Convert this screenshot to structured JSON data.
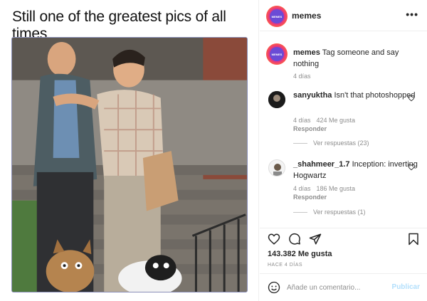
{
  "meme": {
    "caption": "Still one of the greatest pics of all times"
  },
  "post": {
    "username": "memes",
    "avatar_label": "MEMES",
    "caption": "Tag someone and say nothing",
    "caption_time": "4 días"
  },
  "comments": [
    {
      "username": "sanyuktha",
      "text": "Isn't that photoshopped",
      "time": "4 días",
      "likes": "424 Me gusta",
      "reply_label": "Responder",
      "view_replies": "Ver respuestas (23)"
    },
    {
      "username": "_shahmeer_1.7",
      "text": "Inception: inverting Hogwartz",
      "time": "4 días",
      "likes": "186 Me gusta",
      "reply_label": "Responder",
      "view_replies": "Ver respuestas (1)"
    }
  ],
  "actions": {
    "likes_count": "143.382 Me gusta",
    "date": "HACE 4 DÍAS",
    "icons": [
      "heart-icon",
      "comment-icon",
      "share-icon",
      "bookmark-icon"
    ]
  },
  "add_comment": {
    "placeholder": "Añade un comentario...",
    "publish_label": "Publicar"
  },
  "colors": {
    "publish_disabled": "#b2dffc",
    "muted": "#8e8e8e",
    "text": "#262626"
  }
}
